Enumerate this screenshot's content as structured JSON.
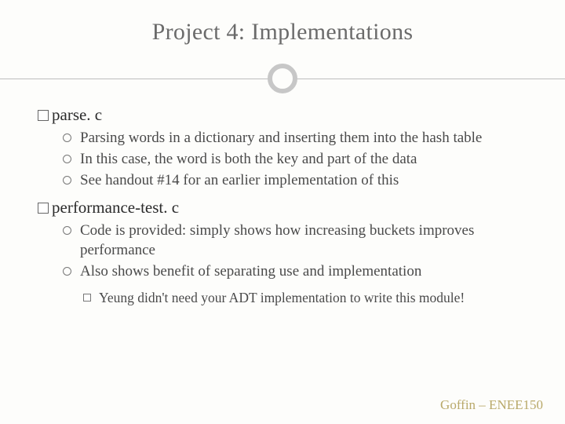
{
  "title": "Project 4: Implementations",
  "sections": [
    {
      "heading": "parse. c",
      "bullets": [
        "Parsing words in a dictionary and inserting them into the hash table",
        "In this case, the word is both the key and part of the data",
        "See handout #14 for an earlier implementation of this"
      ]
    },
    {
      "heading": "performance-test. c",
      "bullets": [
        "Code is provided: simply shows how increasing buckets improves performance",
        "Also shows benefit of separating use and implementation"
      ],
      "subbullets": [
        "Yeung didn't need your ADT implementation to write this module!"
      ]
    }
  ],
  "footer": "Goffin – ENEE150"
}
